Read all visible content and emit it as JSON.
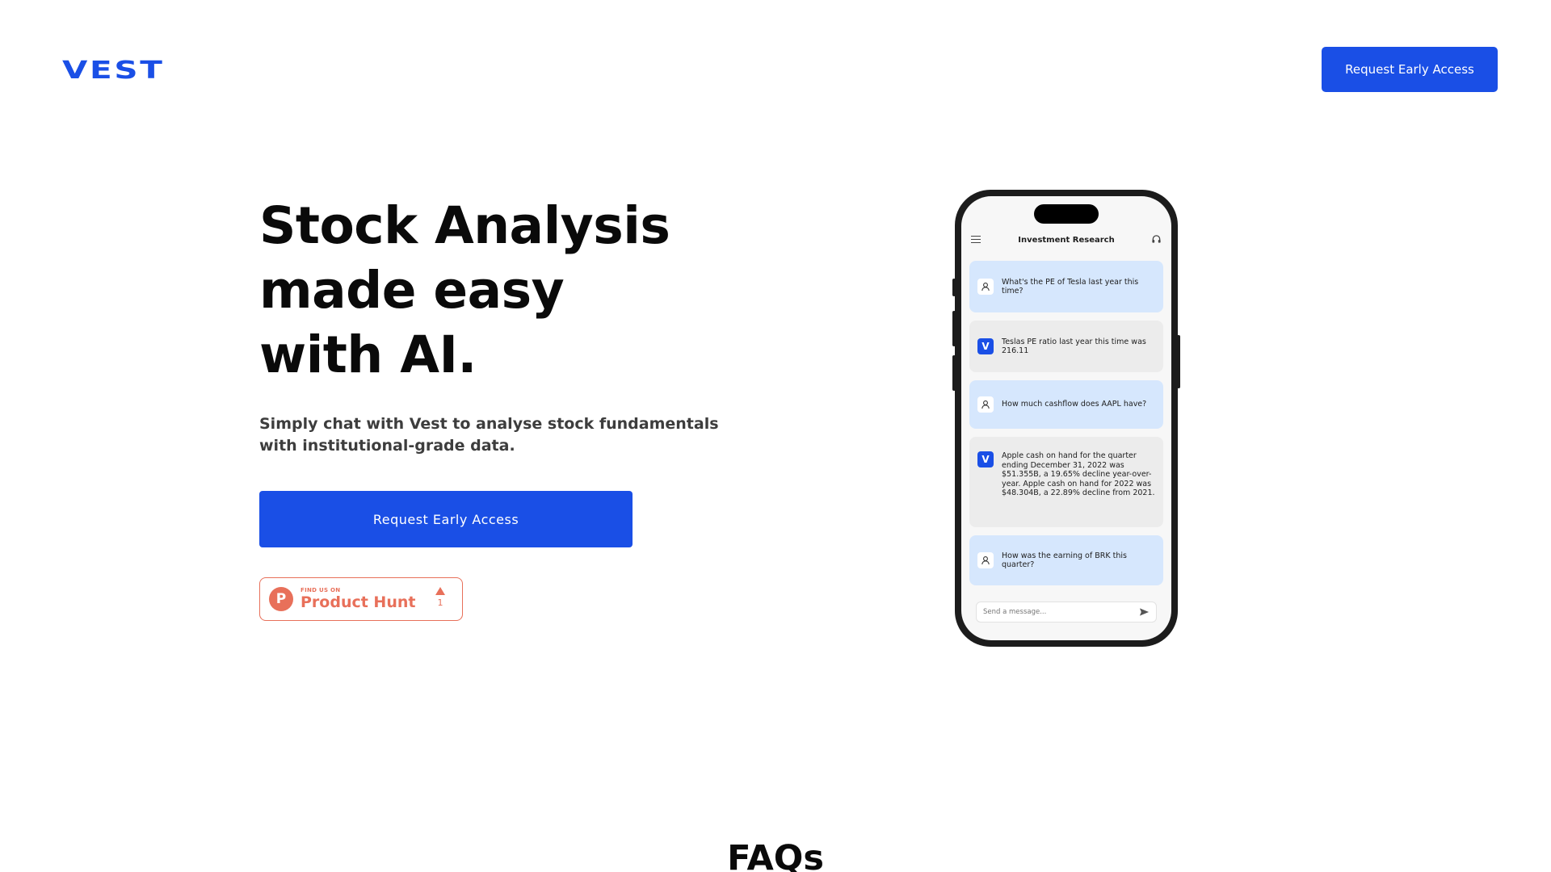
{
  "header": {
    "logo": "VEST",
    "cta_label": "Request Early Access"
  },
  "hero": {
    "title_lines": [
      "Stock Analysis",
      "made easy",
      "with AI."
    ],
    "subtitle": "Simply chat with Vest to analyse stock fundamentals with institutional-grade data.",
    "cta_label": "Request Early Access"
  },
  "product_hunt": {
    "small_label": "FIND US ON",
    "name": "Product Hunt",
    "letter": "P",
    "votes": "1"
  },
  "phone": {
    "app_title": "Investment Research",
    "messages": [
      {
        "role": "user",
        "text": "What's the PE of Tesla last year this time?"
      },
      {
        "role": "bot",
        "avatar": "V",
        "text": "Teslas PE ratio last year this time was 216.11"
      },
      {
        "role": "user",
        "text": "How much cashflow does AAPL have?"
      },
      {
        "role": "bot",
        "avatar": "V",
        "text": "Apple cash on hand for the quarter ending December 31, 2022 was $51.355B, a 19.65% decline year-over-year. Apple cash on hand for 2022 was $48.304B, a 22.89% decline from 2021."
      },
      {
        "role": "user",
        "text": "How was the earning of BRK this quarter?"
      }
    ],
    "composer_placeholder": "Send a message..."
  },
  "faq": {
    "title": "FAQs"
  },
  "colors": {
    "brand_blue": "#1a4fe6",
    "product_hunt": "#e8705a",
    "user_bubble": "#d6e7fd",
    "bot_bubble": "#ececec"
  }
}
